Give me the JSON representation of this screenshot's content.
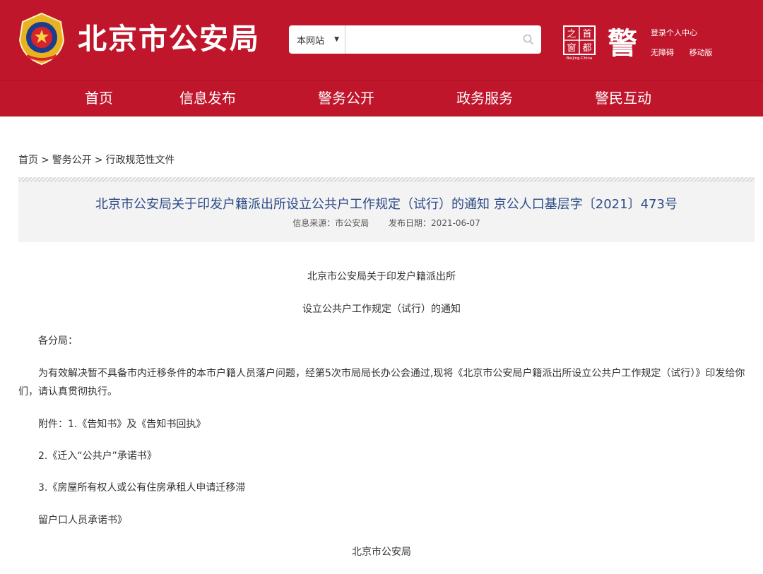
{
  "header": {
    "site_title": "北京市公安局",
    "search": {
      "scope": "本网站",
      "placeholder": ""
    },
    "logo_shoudu": {
      "chars": [
        "之",
        "首",
        "窗",
        "都"
      ],
      "caption": "Beijing-China"
    },
    "logo_jing": {
      "char": "警"
    },
    "links": {
      "login": "登录个人中心",
      "accessibility": "无障碍",
      "mobile": "移动版"
    }
  },
  "nav": [
    "首页",
    "信息发布",
    "警务公开",
    "政务服务",
    "警民互动"
  ],
  "breadcrumb": [
    "首页",
    "警务公开",
    "行政规范性文件"
  ],
  "article": {
    "title": "北京市公安局关于印发户籍派出所设立公共户工作规定（试行）的通知 京公人口基层字〔2021〕473号",
    "source": "信息来源：市公安局",
    "date": "发布日期：2021-06-07",
    "heading1": "北京市公安局关于印发户籍派出所",
    "heading2": "设立公共户工作规定（试行）的通知",
    "salutation": "各分局：",
    "para1_line1": "为有效解决暂不具备市内迁移条件的本市户籍人员落户问题，经第5次市局局长办公会通过,现将《北京市公安局户籍派出所设立公共户工作规定（试行）》印发给你",
    "para1_line2": "们，请认真贯彻执行。",
    "attach1": "附件：1.《告知书》及《告知书回执》",
    "attach2": "2.《迁入“公共户”承诺书》",
    "attach3": "3.《房屋所有权人或公有住房承租人申请迁移滞",
    "attach3_cont": "留户口人员承诺书》",
    "signature": "北京市公安局"
  },
  "colors": {
    "brand_red": "#c0162c",
    "title_blue": "#2c4a86",
    "emblem_gold": "#e8b320"
  }
}
